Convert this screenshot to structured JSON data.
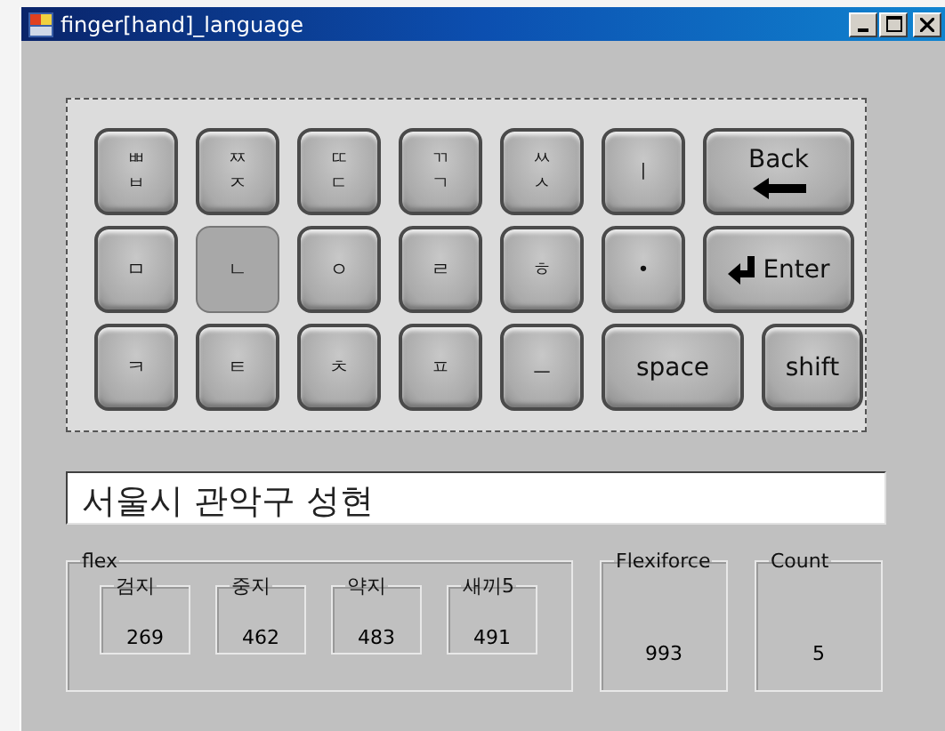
{
  "window": {
    "title": "finger[hand]_language"
  },
  "keyboard": {
    "rows": [
      [
        {
          "kind": "normal",
          "lines": [
            "ㅃ",
            "ㅂ"
          ],
          "selected": false
        },
        {
          "kind": "normal",
          "lines": [
            "ㅉ",
            "ㅈ"
          ],
          "selected": false
        },
        {
          "kind": "normal",
          "lines": [
            "ㄸ",
            "ㄷ"
          ],
          "selected": false
        },
        {
          "kind": "normal",
          "lines": [
            "ㄲ",
            "ㄱ"
          ],
          "selected": false
        },
        {
          "kind": "normal",
          "lines": [
            "ㅆ",
            "ㅅ"
          ],
          "selected": false
        },
        {
          "kind": "normal",
          "lines": [
            "ㅣ"
          ],
          "selected": false
        },
        {
          "kind": "back",
          "lines": [
            "Back"
          ],
          "selected": false
        }
      ],
      [
        {
          "kind": "normal",
          "lines": [
            "ㅁ"
          ],
          "selected": false
        },
        {
          "kind": "normal",
          "lines": [
            "ㄴ"
          ],
          "selected": true
        },
        {
          "kind": "normal",
          "lines": [
            "ㅇ"
          ],
          "selected": false
        },
        {
          "kind": "normal",
          "lines": [
            "ㄹ"
          ],
          "selected": false
        },
        {
          "kind": "normal",
          "lines": [
            "ㅎ"
          ],
          "selected": false
        },
        {
          "kind": "normal",
          "lines": [
            "•"
          ],
          "selected": false
        },
        {
          "kind": "enter",
          "lines": [
            "Enter"
          ],
          "selected": false
        }
      ],
      [
        {
          "kind": "normal",
          "lines": [
            "ㅋ"
          ],
          "selected": false
        },
        {
          "kind": "normal",
          "lines": [
            "ㅌ"
          ],
          "selected": false
        },
        {
          "kind": "normal",
          "lines": [
            "ㅊ"
          ],
          "selected": false
        },
        {
          "kind": "normal",
          "lines": [
            "ㅍ"
          ],
          "selected": false
        },
        {
          "kind": "normal",
          "lines": [
            "ㅡ"
          ],
          "selected": false
        },
        {
          "kind": "space",
          "lines": [
            "space"
          ],
          "selected": false
        },
        {
          "kind": "shift",
          "lines": [
            "shift"
          ],
          "selected": false
        }
      ]
    ]
  },
  "text_field": {
    "value": "서울시 관악구 성현"
  },
  "flex": {
    "label": "flex",
    "sensors": [
      {
        "label": "검지",
        "value": "269"
      },
      {
        "label": "중지",
        "value": "462"
      },
      {
        "label": "약지",
        "value": "483"
      },
      {
        "label": "새끼5",
        "value": "491"
      }
    ]
  },
  "flexiforce": {
    "label": "Flexiforce",
    "value": "993"
  },
  "count": {
    "label": "Count",
    "value": "5"
  }
}
